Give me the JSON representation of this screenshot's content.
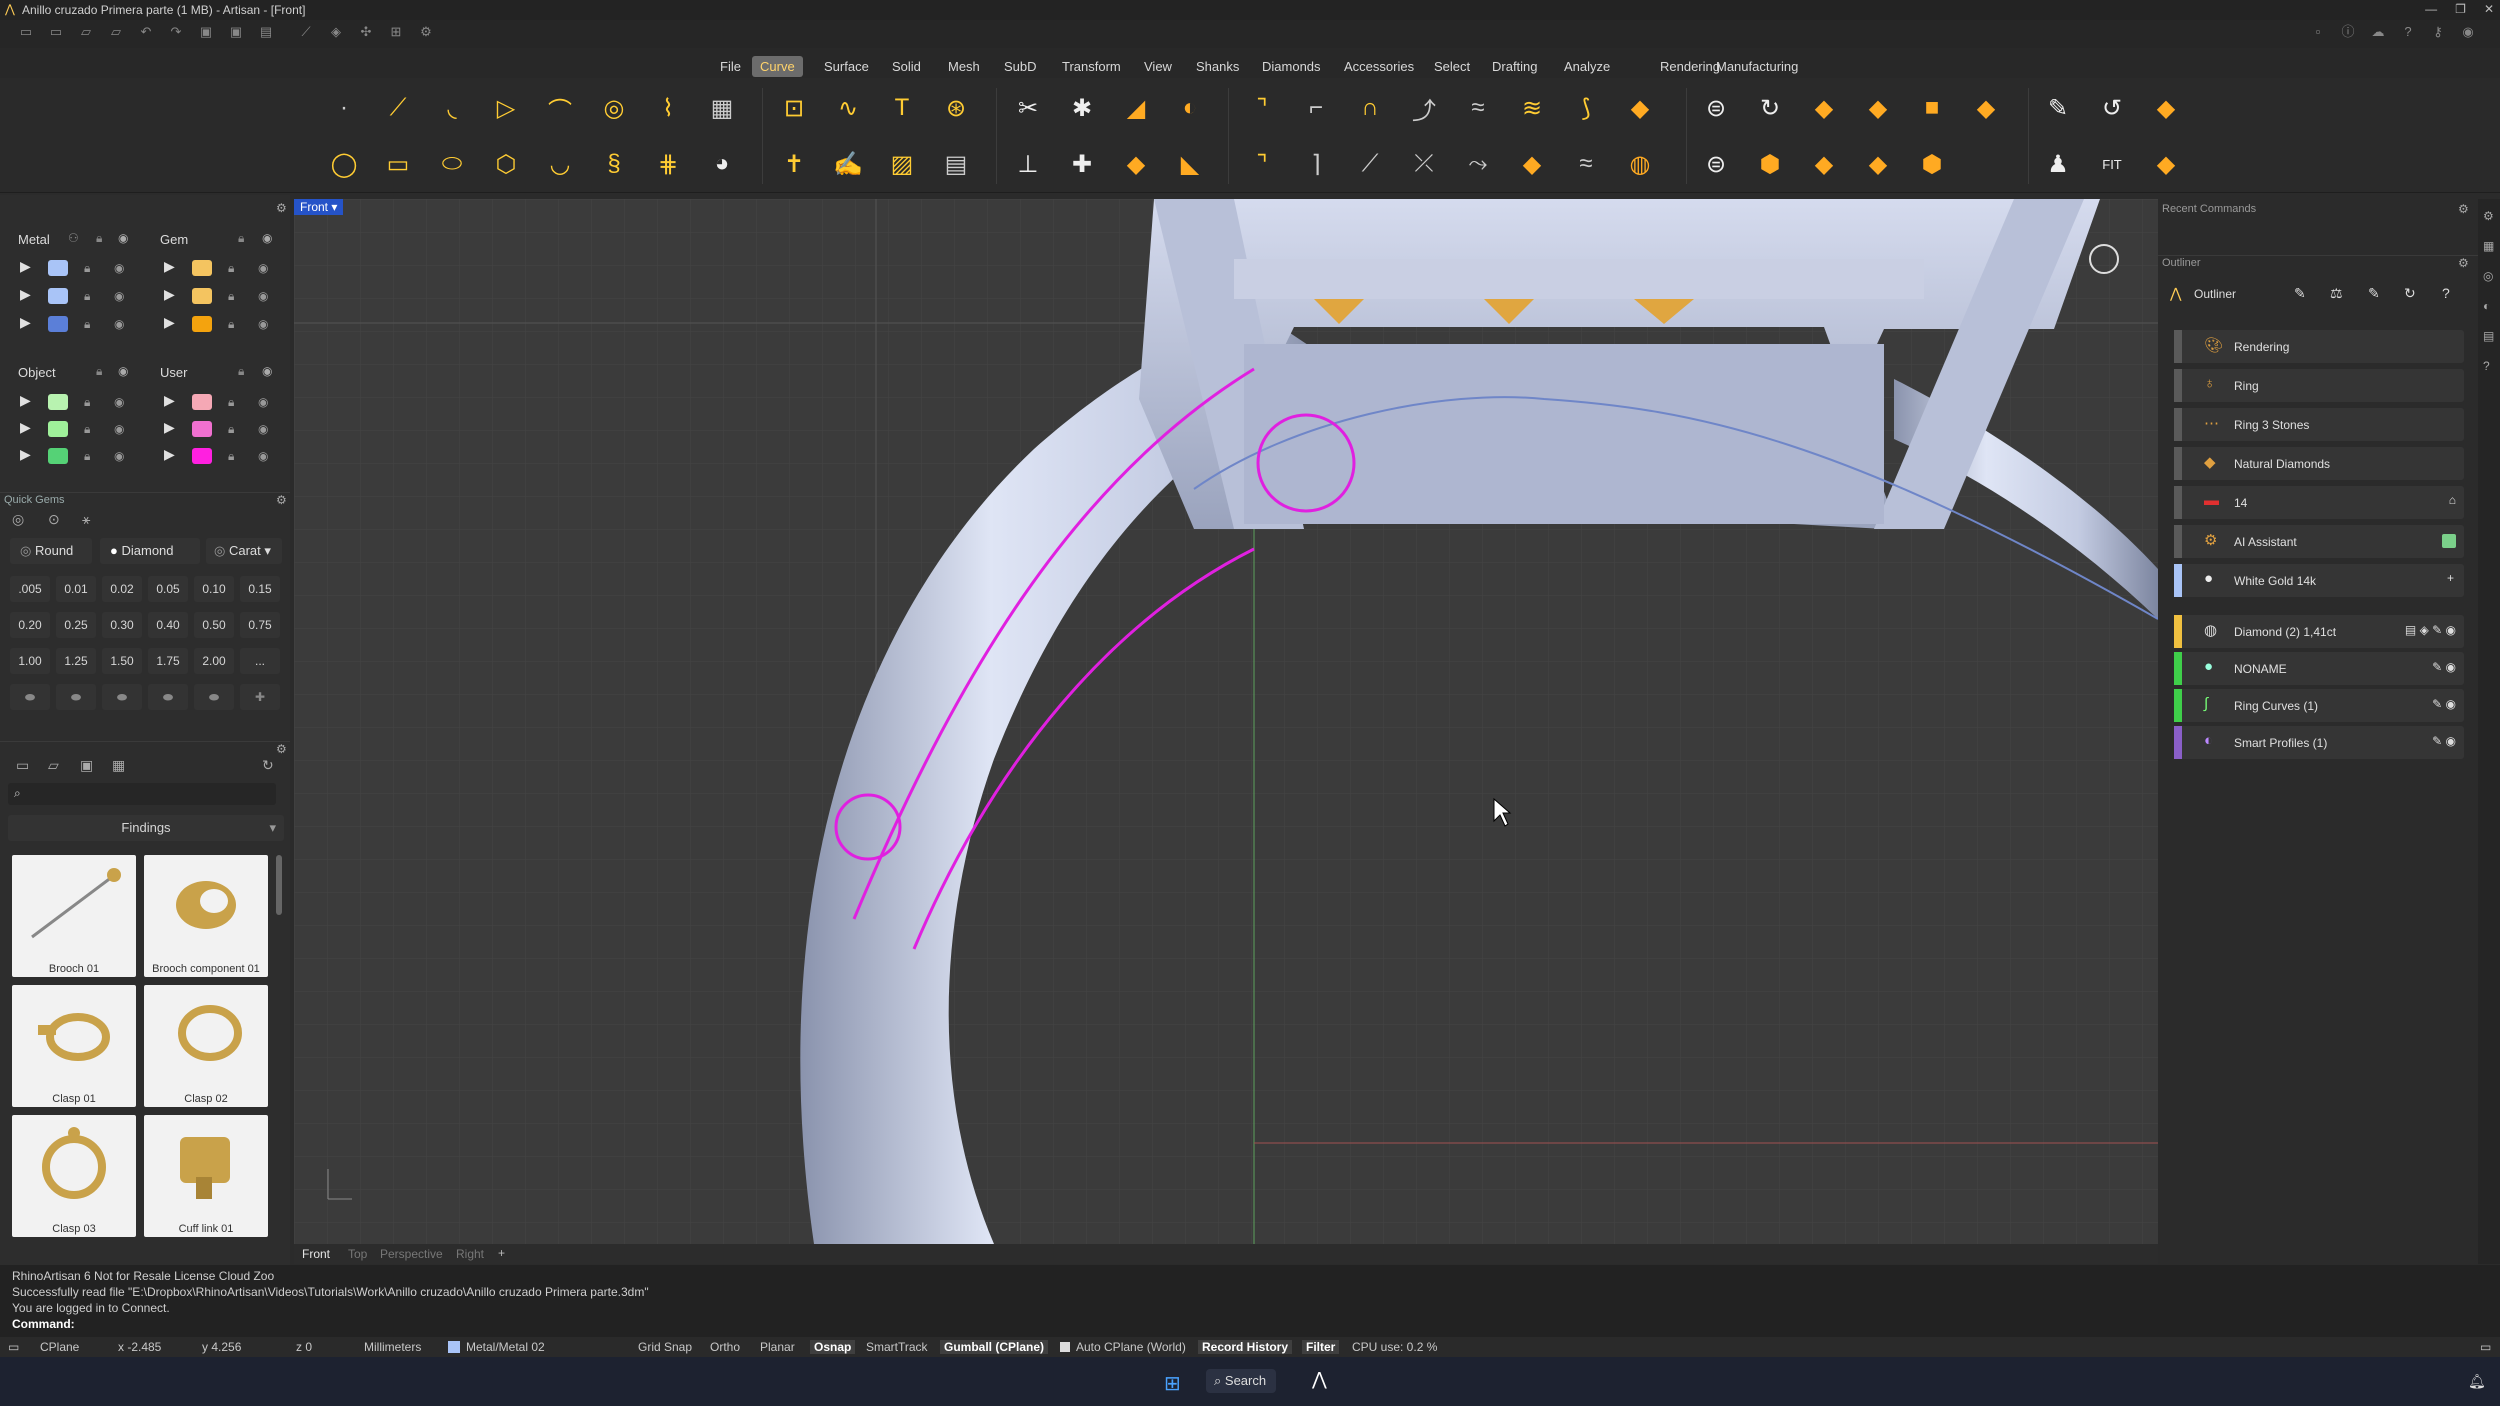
{
  "window": {
    "title": "Anillo cruzado Primera parte (1 MB) - Artisan - [Front]"
  },
  "menu": [
    "File",
    "Curve",
    "Surface",
    "Solid",
    "Mesh",
    "SubD",
    "Transform",
    "View",
    "Shanks",
    "Diamonds",
    "Accessories",
    "Select",
    "Drafting",
    "Analyze",
    "Rendering",
    "Manufacturing"
  ],
  "menu_active": "Curve",
  "left": {
    "metal": {
      "title": "Metal",
      "colors": [
        "#a9c4f7",
        "#a9c4f7",
        "#5b7fd8"
      ]
    },
    "gem": {
      "title": "Gem",
      "colors": [
        "#f4c460",
        "#f4c460",
        "#f4a30e"
      ]
    },
    "object": {
      "title": "Object",
      "colors": [
        "#b8f2b0",
        "#9ff09a",
        "#55d276"
      ]
    },
    "user": {
      "title": "User",
      "colors": [
        "#f5a8b5",
        "#f070d0",
        "#ff20e0"
      ]
    },
    "quick_gems": {
      "title": "Quick Gems",
      "shape": "Round",
      "material": "Diamond",
      "unit": "Carat",
      "sizes": [
        ".005",
        "0.01",
        "0.02",
        "0.05",
        "0.10",
        "0.15",
        "0.20",
        "0.25",
        "0.30",
        "0.40",
        "0.50",
        "0.75",
        "1.00",
        "1.25",
        "1.50",
        "1.75",
        "2.00",
        "..."
      ]
    },
    "library": {
      "category": "Findings",
      "items": [
        "Brooch 01",
        "Brooch component 01",
        "Clasp 01",
        "Clasp 02",
        "Clasp 03",
        "Cuff link 01"
      ]
    }
  },
  "viewport": {
    "label": "Front",
    "tabs": [
      "Front",
      "Top",
      "Perspective",
      "Right"
    ],
    "add_tab": "+"
  },
  "right": {
    "recent_title": "Recent Commands",
    "outliner_section": "Outliner",
    "outliner_title": "Outliner",
    "items": [
      {
        "label": "Rendering",
        "color": "#777"
      },
      {
        "label": "Ring",
        "color": "#777"
      },
      {
        "label": "Ring 3 Stones",
        "color": "#777"
      },
      {
        "label": "Natural Diamonds",
        "color": "#777"
      },
      {
        "label": "14",
        "color": "#777"
      },
      {
        "label": "AI Assistant",
        "color": "#777"
      },
      {
        "label": "White Gold 14k",
        "color": "#a9c4f7"
      },
      {
        "label": "Diamond (2) 1,41ct",
        "color": "#f0c040"
      },
      {
        "label": "NONAME",
        "color": "#3fcf4a"
      },
      {
        "label": "Ring Curves (1)",
        "color": "#3fcf4a"
      },
      {
        "label": "Smart Profiles (1)",
        "color": "#8a5fc8"
      }
    ]
  },
  "command": {
    "lines": [
      "RhinoArtisan 6 Not for Resale License Cloud Zoo",
      "Successfully read file \"E:\\Dropbox\\RhinoArtisan\\Videos\\Tutorials\\Work\\Anillo cruzado\\Anillo cruzado Primera parte.3dm\"",
      "You are logged in to Connect."
    ],
    "prompt": "Command:"
  },
  "status": {
    "cplane": "CPlane",
    "x": "x -2.485",
    "y": "y 4.256",
    "z": "z 0",
    "units": "Millimeters",
    "layer": "Metal/Metal 02",
    "grid_snap": "Grid Snap",
    "ortho": "Ortho",
    "planar": "Planar",
    "osnap": "Osnap",
    "smarttrack": "SmartTrack",
    "gumball": "Gumball (CPlane)",
    "auto_cplane": "Auto CPlane (World)",
    "record_history": "Record History",
    "filter": "Filter",
    "cpu": "CPU use: 0.2 %"
  },
  "taskbar": {
    "search": "Search"
  }
}
